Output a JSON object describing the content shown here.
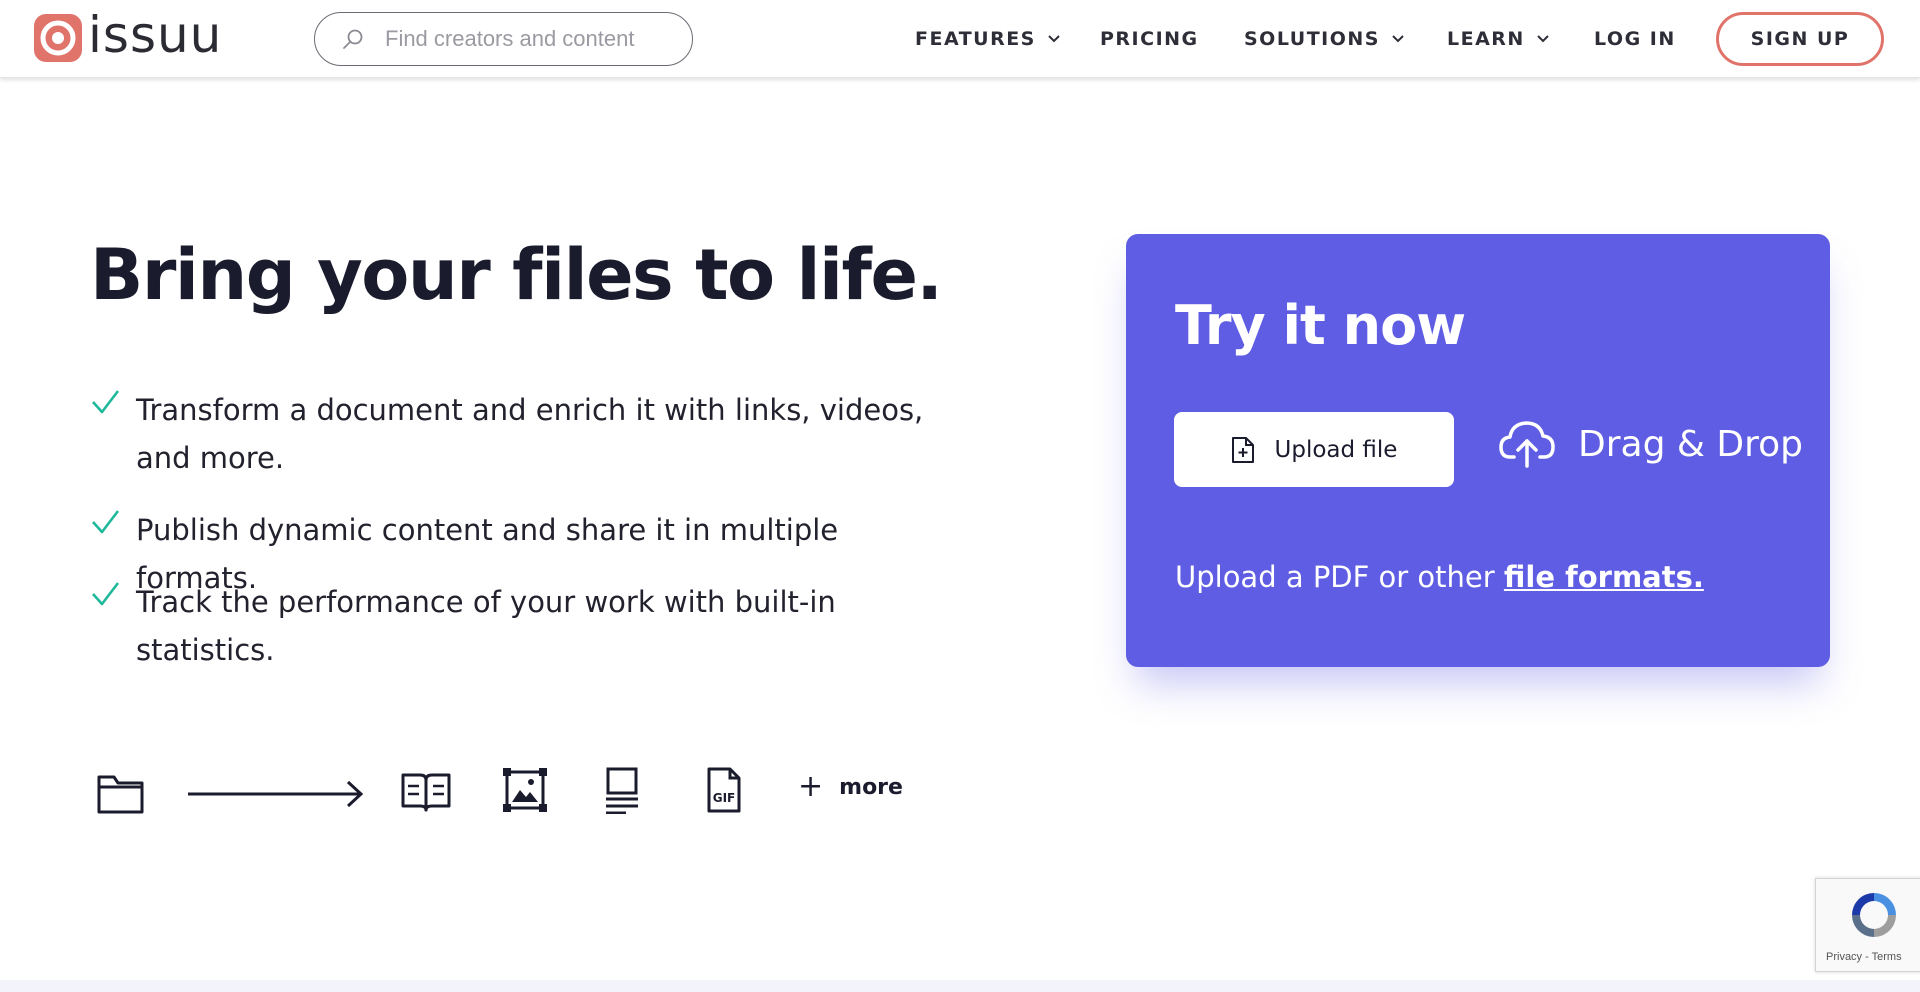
{
  "brand": {
    "name": "issuu",
    "accent": "#e0746b",
    "panel_color": "#5e5de3"
  },
  "search": {
    "placeholder": "Find creators and content"
  },
  "nav": {
    "features": "FEATURES",
    "pricing": "PRICING",
    "solutions": "SOLUTIONS",
    "learn": "LEARN",
    "login": "LOG IN",
    "signup": "SIGN UP"
  },
  "hero": {
    "title": "Bring your files to life.",
    "features": [
      "Transform a document and enrich it with links, videos, and more.",
      "Publish dynamic content and share it in multiple formats.",
      "Track the performance of your work with built-in statistics."
    ]
  },
  "formats": {
    "icons": [
      "folder-icon",
      "arrow-right-icon",
      "book-icon",
      "image-icon",
      "article-icon",
      "gif-file-icon"
    ],
    "more_label": "more"
  },
  "panel": {
    "title": "Try it now",
    "upload_label": "Upload file",
    "dragdrop_label": "Drag & Drop",
    "note_prefix": "Upload a PDF or other ",
    "note_link": "file formats."
  },
  "recaptcha": {
    "links": "Privacy - Terms"
  }
}
